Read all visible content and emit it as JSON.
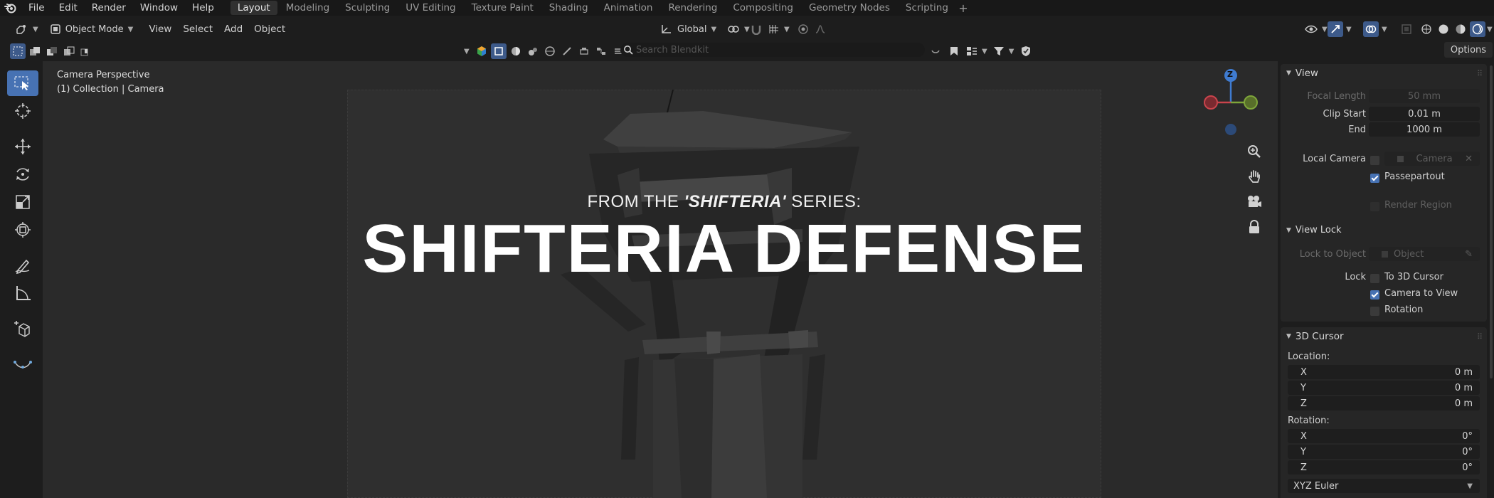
{
  "menu": {
    "items": [
      "File",
      "Edit",
      "Render",
      "Window",
      "Help"
    ]
  },
  "workspaces": {
    "tabs": [
      "Layout",
      "Modeling",
      "Sculpting",
      "UV Editing",
      "Texture Paint",
      "Shading",
      "Animation",
      "Rendering",
      "Compositing",
      "Geometry Nodes",
      "Scripting"
    ],
    "active": "Layout"
  },
  "header": {
    "mode": "Object Mode",
    "menus": [
      "View",
      "Select",
      "Add",
      "Object"
    ],
    "transform_orientation": "Global"
  },
  "search": {
    "placeholder": "Search Blendkit"
  },
  "options_label": "Options",
  "viewport": {
    "info_line1": "Camera Perspective",
    "info_line2": "(1) Collection | Camera",
    "kicker_prefix": "FROM THE ",
    "kicker_series": "'SHIFTERIA'",
    "kicker_suffix": " SERIES:",
    "headline": "SHIFTERIA DEFENSE",
    "gizmo_axis_label": "Z"
  },
  "npanel": {
    "view": {
      "title": "View",
      "focal_length_label": "Focal Length",
      "focal_length": "50 mm",
      "clip_start_label": "Clip Start",
      "clip_start": "0.01 m",
      "end_label": "End",
      "end": "1000 m",
      "local_camera_label": "Local Camera",
      "local_camera_value": "Camera",
      "passepartout_label": "Passepartout",
      "passepartout": true,
      "render_region_label": "Render Region",
      "render_region": false
    },
    "view_lock": {
      "title": "View Lock",
      "lock_to_object_label": "Lock to Object",
      "lock_to_object_value": "Object",
      "lock_label": "Lock",
      "to_3d_cursor_label": "To 3D Cursor",
      "to_3d_cursor": false,
      "camera_to_view_label": "Camera to View",
      "camera_to_view": true,
      "rotation_label": "Rotation",
      "rotation": false
    },
    "cursor": {
      "title": "3D Cursor",
      "location_label": "Location:",
      "location": [
        {
          "axis": "X",
          "value": "0 m"
        },
        {
          "axis": "Y",
          "value": "0 m"
        },
        {
          "axis": "Z",
          "value": "0 m"
        }
      ],
      "rotation_label": "Rotation:",
      "rotation": [
        {
          "axis": "X",
          "value": "0°"
        },
        {
          "axis": "Y",
          "value": "0°"
        },
        {
          "axis": "Z",
          "value": "0°"
        }
      ],
      "rotation_mode": "XYZ Euler"
    }
  },
  "colors": {
    "accent": "#4772b3",
    "axis_x": "#c9444c",
    "axis_y": "#7ea53a",
    "axis_z": "#3f7bd0"
  }
}
